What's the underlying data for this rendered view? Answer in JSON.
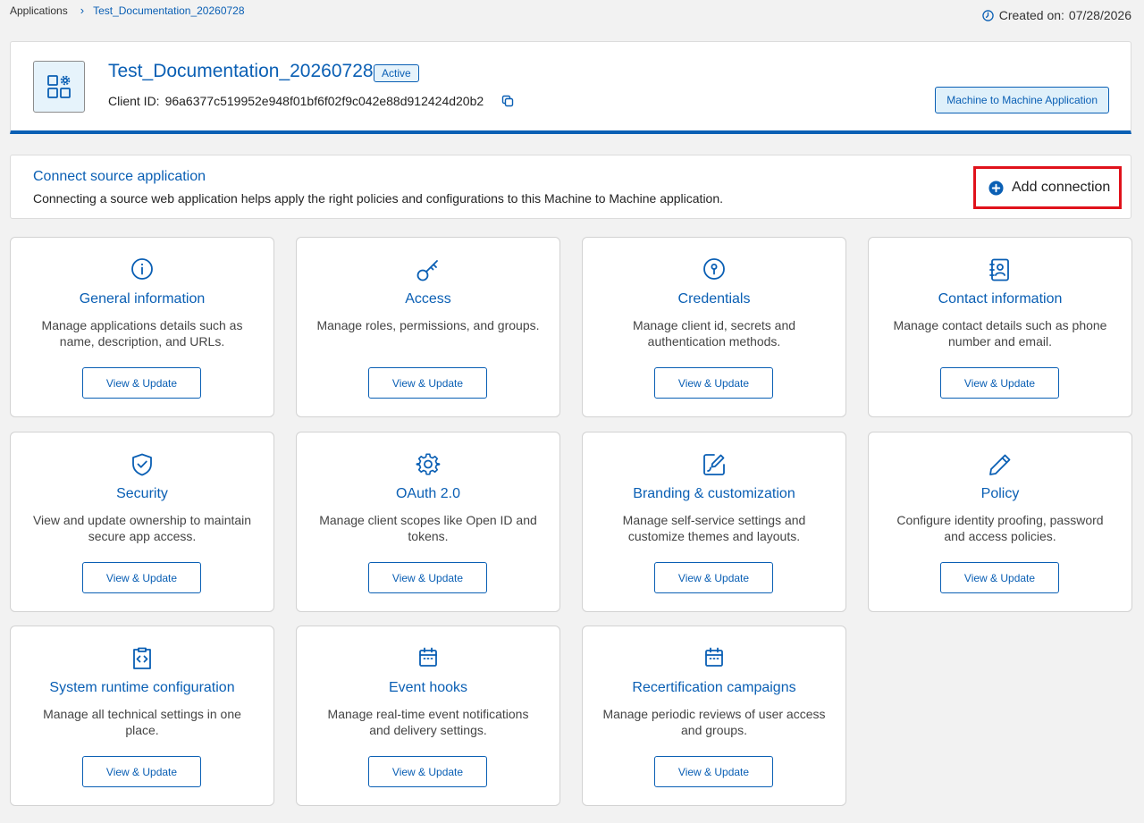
{
  "breadcrumb": {
    "root": "Applications",
    "separator": "›",
    "current": "Test_Documentation_20260728"
  },
  "created": {
    "label": "Created on:",
    "date": "07/28/2026",
    "icon": "clock-icon"
  },
  "app": {
    "title": "Test_Documentation_20260728",
    "status": "Active",
    "client_id_label": "Client ID:",
    "client_id": "96a6377c519952e948f01bf6f02f9c042e88d912424d20b2",
    "type_button": "Machine to Machine Application",
    "icon": "app-grid-gear-icon"
  },
  "connect": {
    "title": "Connect source application",
    "description": "Connecting a source web application helps apply the right policies and configurations to this Machine to Machine application.",
    "add_label": "Add connection"
  },
  "colors": {
    "accent": "#0a5fb4",
    "highlight_border": "#e0121b",
    "background": "#f2f2f2"
  },
  "cards": [
    {
      "title": "General information",
      "description": "Manage applications details such as name, description, and URLs.",
      "button": "View & Update",
      "icon": "info-icon"
    },
    {
      "title": "Access",
      "description": "Manage roles, permissions, and groups.",
      "button": "View & Update",
      "icon": "key-icon"
    },
    {
      "title": "Credentials",
      "description": "Manage client id, secrets and authentication methods.",
      "button": "View & Update",
      "icon": "keyhole-icon"
    },
    {
      "title": "Contact information",
      "description": "Manage contact details such as phone number and email.",
      "button": "View & Update",
      "icon": "contact-book-icon"
    },
    {
      "title": "Security",
      "description": "View and update ownership to maintain secure app access.",
      "button": "View & Update",
      "icon": "shield-check-icon"
    },
    {
      "title": "OAuth 2.0",
      "description": "Manage client scopes like Open ID and tokens.",
      "button": "View & Update",
      "icon": "gear-icon"
    },
    {
      "title": "Branding & customization",
      "description": "Manage self-service settings and customize themes and layouts.",
      "button": "View & Update",
      "icon": "brush-edit-icon"
    },
    {
      "title": "Policy",
      "description": "Configure identity proofing, password and access policies.",
      "button": "View & Update",
      "icon": "pencil-icon"
    },
    {
      "title": "System runtime configuration",
      "description": "Manage all technical settings in one place.",
      "button": "View & Update",
      "icon": "code-clipboard-icon"
    },
    {
      "title": "Event hooks",
      "description": "Manage real-time event notifications and delivery settings.",
      "button": "View & Update",
      "icon": "calendar-icon"
    },
    {
      "title": "Recertification campaigns",
      "description": "Manage periodic reviews of user access and groups.",
      "button": "View & Update",
      "icon": "calendar-icon"
    }
  ]
}
